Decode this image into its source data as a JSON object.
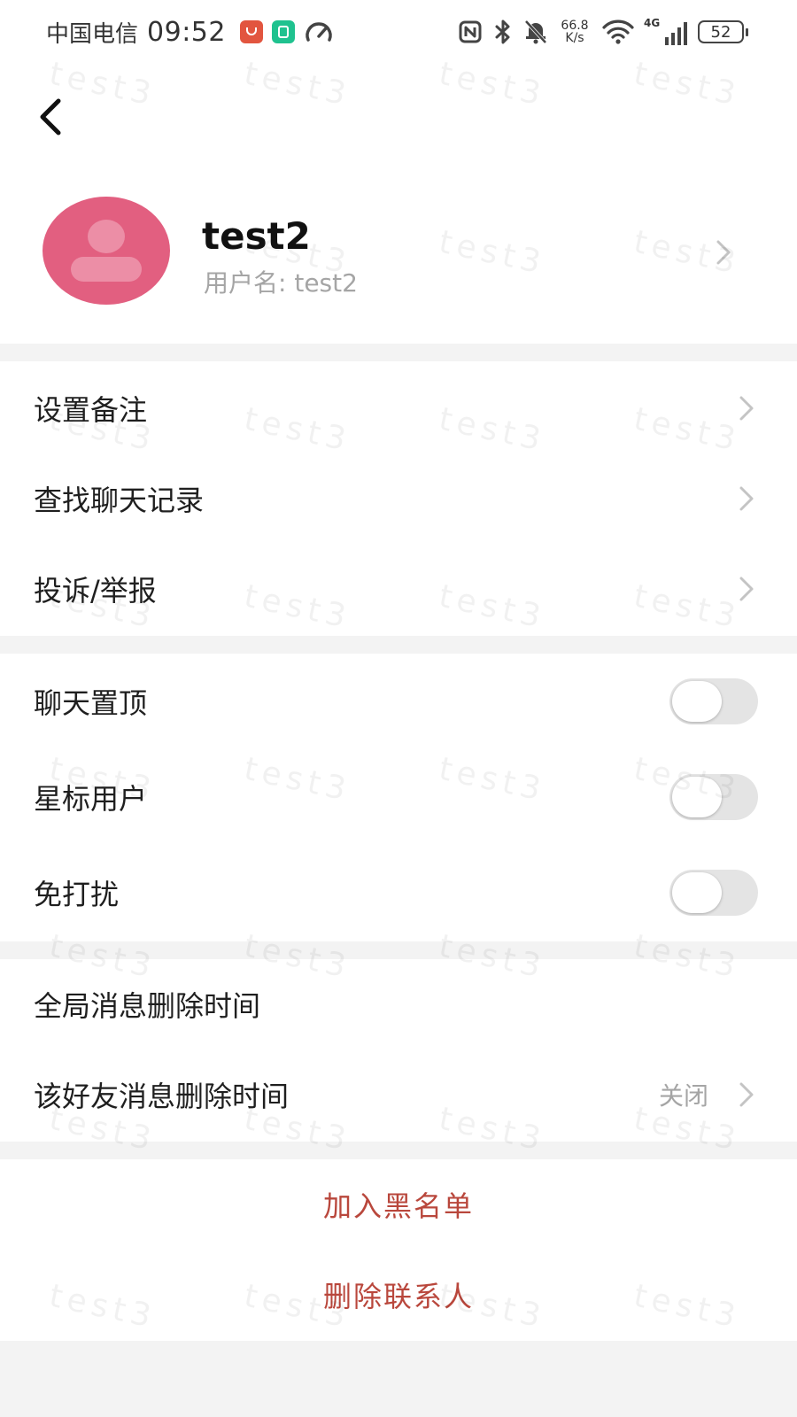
{
  "status_bar": {
    "carrier": "中国电信",
    "time": "09:52",
    "net_speed_value": "66.8",
    "net_speed_unit": "K/s",
    "network_type": "4G",
    "battery": "52"
  },
  "header": {
    "back_icon": "chevron-left-icon"
  },
  "profile": {
    "name": "test2",
    "username": "用户名: test2",
    "avatar_color": "#e25f80"
  },
  "menu_section_1": {
    "items": [
      {
        "label": "设置备注"
      },
      {
        "label": "查找聊天记录"
      },
      {
        "label": "投诉/举报"
      }
    ]
  },
  "toggle_section": {
    "items": [
      {
        "label": "聊天置顶",
        "enabled": false
      },
      {
        "label": "星标用户",
        "enabled": false
      },
      {
        "label": "免打扰",
        "enabled": false
      }
    ]
  },
  "delete_time_section": {
    "global_label": "全局消息删除时间",
    "friend_label": "该好友消息删除时间",
    "friend_value": "关闭"
  },
  "actions": {
    "blacklist_label": "加入黑名单",
    "delete_contact_label": "删除联系人",
    "accent_color": "#b9473c"
  },
  "watermark": {
    "text": "test3"
  }
}
